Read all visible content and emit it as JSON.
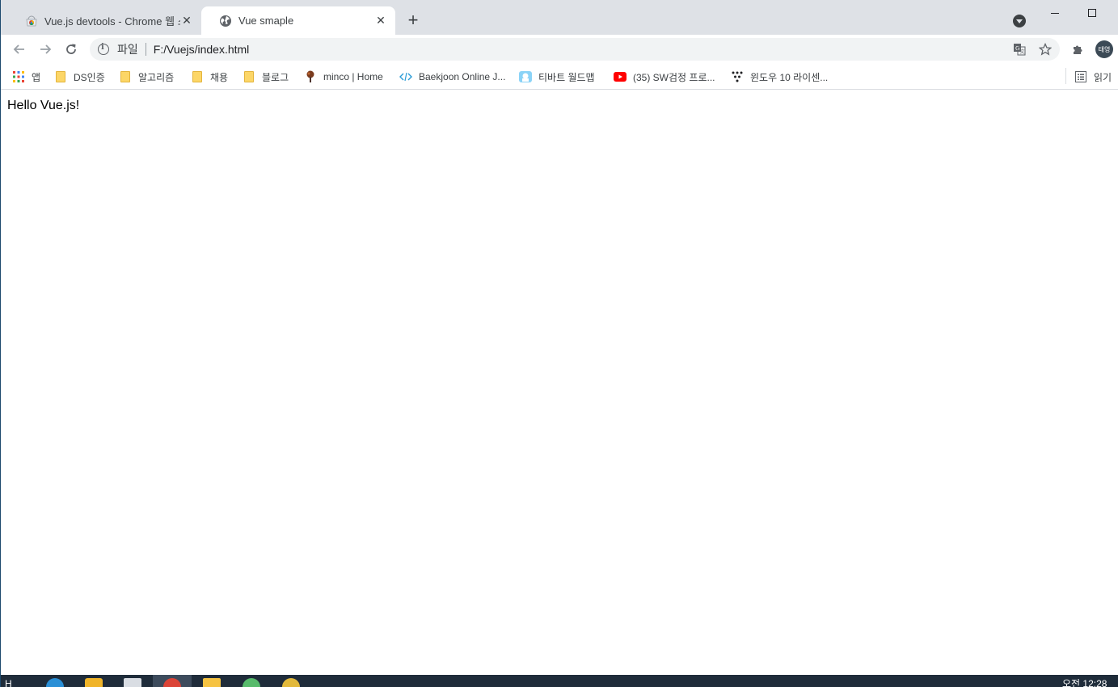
{
  "tabs": [
    {
      "title": "Vue.js devtools - Chrome 웹 스토어",
      "close": "✕",
      "favicon": "chrome-webstore-icon",
      "active": false
    },
    {
      "title": "Vue smaple",
      "close": "✕",
      "favicon": "globe-icon",
      "active": true
    }
  ],
  "tabstrip": {
    "new_tab": "+"
  },
  "toolbar": {
    "scheme_label": "파일",
    "url": "F:/Vuejs/index.html",
    "avatar_text": "태영"
  },
  "bookmarks": [
    {
      "label": "앱",
      "icon": "apps-grid-icon"
    },
    {
      "label": "DS인증",
      "icon": "folder-icon"
    },
    {
      "label": "알고리즘",
      "icon": "folder-icon"
    },
    {
      "label": "채용",
      "icon": "folder-icon"
    },
    {
      "label": "블로그",
      "icon": "folder-icon"
    },
    {
      "label": "minco | Home",
      "icon": "tree-icon"
    },
    {
      "label": "Baekjoon Online J...",
      "icon": "code-icon"
    },
    {
      "label": "티바트 월드맵",
      "icon": "map-icon"
    },
    {
      "label": "(35) SW검정 프로...",
      "icon": "youtube-icon"
    },
    {
      "label": "윈도우 10 라이센...",
      "icon": "dots-icon"
    },
    {
      "label": "읽기 ",
      "icon": "reading-list-icon"
    }
  ],
  "content": {
    "text": "Hello Vue.js!"
  },
  "taskbar": {
    "left_text": "H",
    "clock": "오전 12:28"
  },
  "colors": {
    "tabstrip": "#dee1e6",
    "omnibox": "#f1f3f4",
    "taskbar": "#1f2c3a"
  }
}
